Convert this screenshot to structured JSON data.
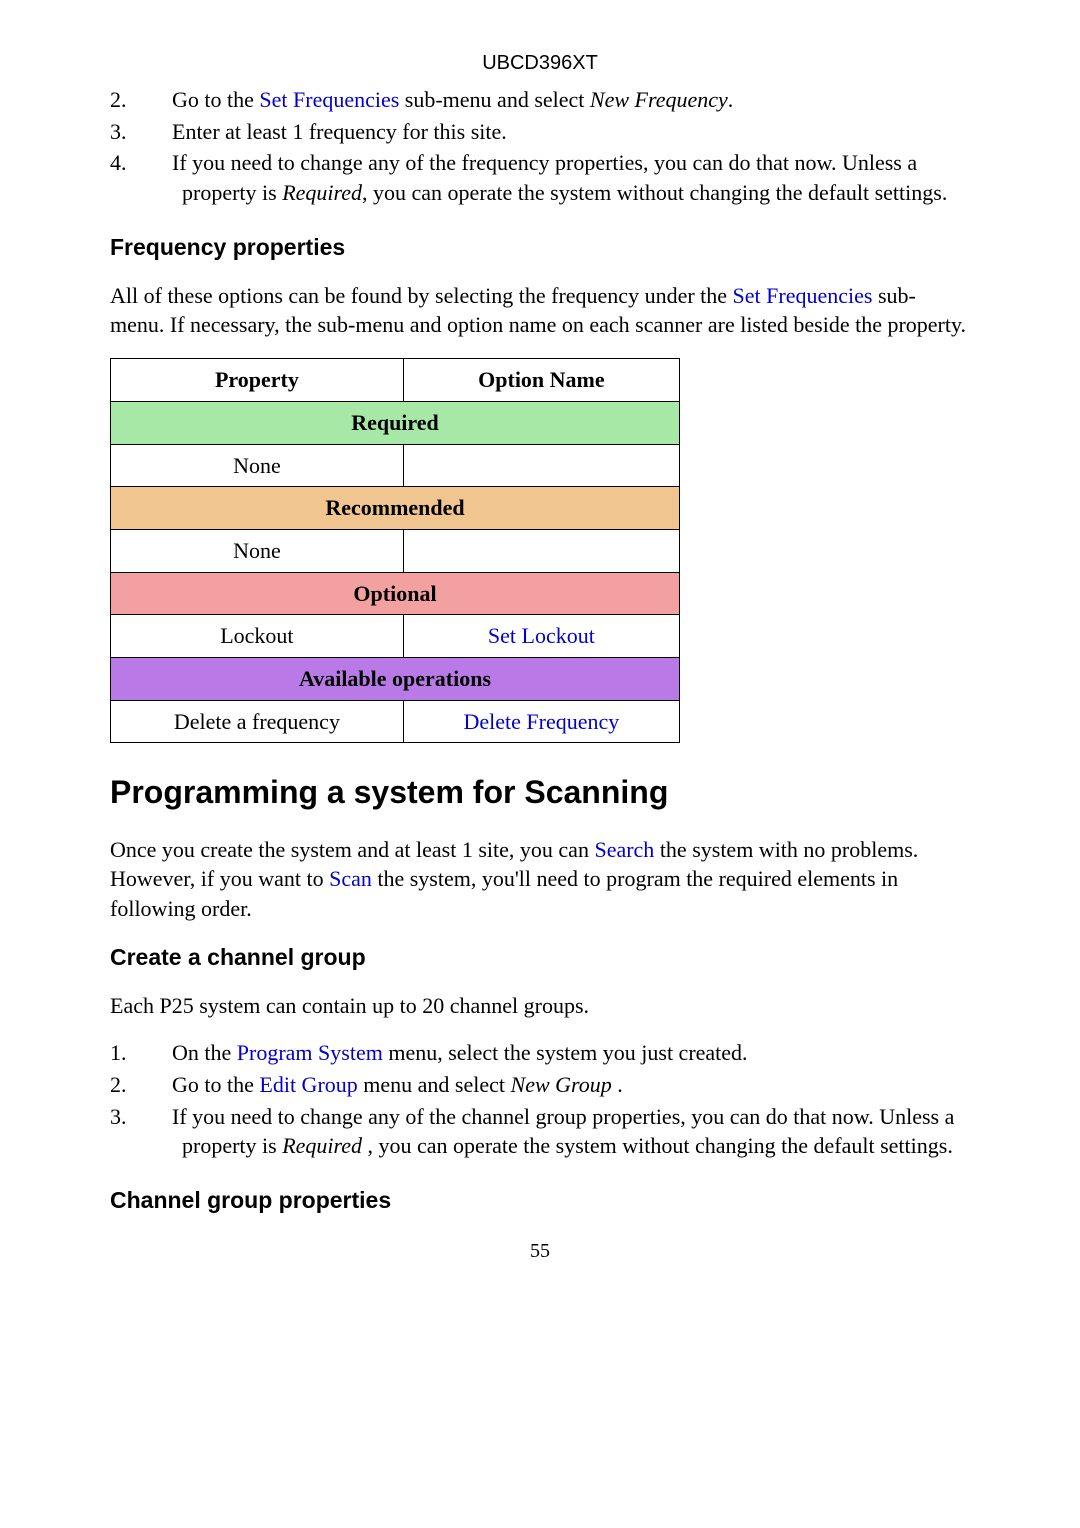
{
  "header": {
    "code": "UBCD396XT"
  },
  "list1": {
    "items": [
      {
        "num": "2.",
        "pre": "Go to the ",
        "link": "Set Frequencies",
        "mid": " sub-menu and select ",
        "italic": "New Frequency",
        "tail": "."
      },
      {
        "num": "3.",
        "pre": "Enter at least 1 frequency for this site.",
        "link": "",
        "mid": "",
        "italic": "",
        "tail": ""
      },
      {
        "num": "4.",
        "pre": "If you need to change any of the frequency properties, you can do that now. Unless a property is ",
        "link": "",
        "mid": "",
        "italic": "Required",
        "tail": ", you can operate the system without changing the default settings."
      }
    ]
  },
  "freq_props": {
    "heading": "Frequency properties",
    "intro_a": "All of these options can be found by selecting the frequency under the ",
    "intro_link": "Set Frequencies",
    "intro_b": " sub-menu. If necessary, the sub-menu and option name on each scanner are listed beside the property."
  },
  "table": {
    "head1": "Property",
    "head2": "Option Name",
    "required": "Required",
    "none1": "None",
    "recommended": "Recommended",
    "none2": "None",
    "optional": "Optional",
    "lockout": "Lockout",
    "set_lockout": "Set Lockout",
    "available": "Available operations",
    "delete_freq_label": "Delete a frequency",
    "delete_freq_link": "Delete Frequency"
  },
  "prog": {
    "heading": "Programming a system for Scanning",
    "p_a": "Once you create the system and at least 1 site, you can ",
    "p_link1": "Search",
    "p_b": " the system with no problems. However, if you want to ",
    "p_link2": "Scan",
    "p_c": " the system, you'll need to program the required elements in following order."
  },
  "create_group": {
    "heading": "Create a channel group",
    "intro": "Each P25 system can contain up to 20 channel groups."
  },
  "list2": {
    "items": [
      {
        "num": "1.",
        "pre": "On the ",
        "link": "Program System",
        "mid": " menu, select the system you just created.",
        "italic": "",
        "tail": ""
      },
      {
        "num": "2.",
        "pre": "Go to the ",
        "link": "Edit Group",
        "mid": " menu and select ",
        "italic": "New Group",
        "tail": " ."
      },
      {
        "num": "3.",
        "pre": "If you need to change any of the channel group properties, you can do that now. Unless a property is ",
        "link": "",
        "mid": "",
        "italic": "Required",
        "tail": " , you can operate the system without changing the default settings."
      }
    ]
  },
  "channel_group_props": {
    "heading": "Channel group properties"
  },
  "page": {
    "num": "55"
  }
}
